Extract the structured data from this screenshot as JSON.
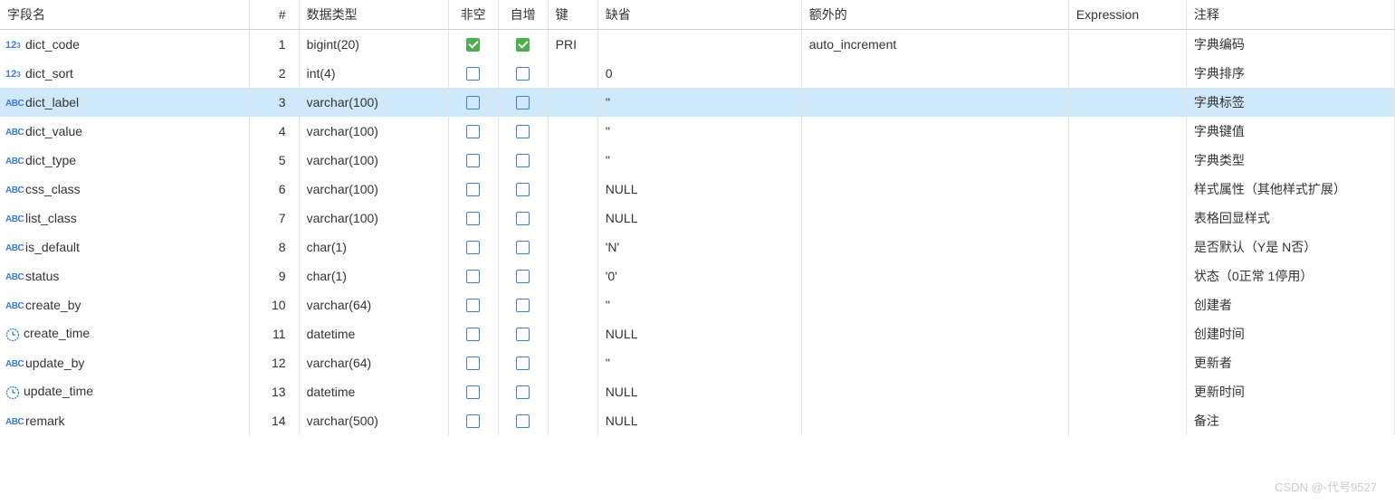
{
  "headers": {
    "name": "字段名",
    "num": "#",
    "type": "数据类型",
    "notnull": "非空",
    "autoinc": "自增",
    "key": "键",
    "default": "缺省",
    "extra": "额外的",
    "expr": "Expression",
    "comment": "注释"
  },
  "rows": [
    {
      "icon": "num",
      "name": "dict_code",
      "num": "1",
      "type": "bigint(20)",
      "notnull": true,
      "autoinc": true,
      "key": "PRI",
      "default": "",
      "extra": "auto_increment",
      "expr": "",
      "comment": "字典编码",
      "selected": false
    },
    {
      "icon": "num",
      "name": "dict_sort",
      "num": "2",
      "type": "int(4)",
      "notnull": false,
      "autoinc": false,
      "key": "",
      "default": "0",
      "extra": "",
      "expr": "",
      "comment": "字典排序",
      "selected": false
    },
    {
      "icon": "abc",
      "name": "dict_label",
      "num": "3",
      "type": "varchar(100)",
      "notnull": false,
      "autoinc": false,
      "key": "",
      "default": "''",
      "extra": "",
      "expr": "",
      "comment": "字典标签",
      "selected": true
    },
    {
      "icon": "abc",
      "name": "dict_value",
      "num": "4",
      "type": "varchar(100)",
      "notnull": false,
      "autoinc": false,
      "key": "",
      "default": "''",
      "extra": "",
      "expr": "",
      "comment": "字典键值",
      "selected": false
    },
    {
      "icon": "abc",
      "name": "dict_type",
      "num": "5",
      "type": "varchar(100)",
      "notnull": false,
      "autoinc": false,
      "key": "",
      "default": "''",
      "extra": "",
      "expr": "",
      "comment": "字典类型",
      "selected": false
    },
    {
      "icon": "abc",
      "name": "css_class",
      "num": "6",
      "type": "varchar(100)",
      "notnull": false,
      "autoinc": false,
      "key": "",
      "default": "NULL",
      "extra": "",
      "expr": "",
      "comment": "样式属性（其他样式扩展）",
      "selected": false
    },
    {
      "icon": "abc",
      "name": "list_class",
      "num": "7",
      "type": "varchar(100)",
      "notnull": false,
      "autoinc": false,
      "key": "",
      "default": "NULL",
      "extra": "",
      "expr": "",
      "comment": "表格回显样式",
      "selected": false
    },
    {
      "icon": "abc",
      "name": "is_default",
      "num": "8",
      "type": "char(1)",
      "notnull": false,
      "autoinc": false,
      "key": "",
      "default": "'N'",
      "extra": "",
      "expr": "",
      "comment": "是否默认（Y是 N否）",
      "selected": false
    },
    {
      "icon": "abc",
      "name": "status",
      "num": "9",
      "type": "char(1)",
      "notnull": false,
      "autoinc": false,
      "key": "",
      "default": "'0'",
      "extra": "",
      "expr": "",
      "comment": "状态（0正常 1停用）",
      "selected": false
    },
    {
      "icon": "abc",
      "name": "create_by",
      "num": "10",
      "type": "varchar(64)",
      "notnull": false,
      "autoinc": false,
      "key": "",
      "default": "''",
      "extra": "",
      "expr": "",
      "comment": "创建者",
      "selected": false
    },
    {
      "icon": "clock",
      "name": "create_time",
      "num": "11",
      "type": "datetime",
      "notnull": false,
      "autoinc": false,
      "key": "",
      "default": "NULL",
      "extra": "",
      "expr": "",
      "comment": "创建时间",
      "selected": false
    },
    {
      "icon": "abc",
      "name": "update_by",
      "num": "12",
      "type": "varchar(64)",
      "notnull": false,
      "autoinc": false,
      "key": "",
      "default": "''",
      "extra": "",
      "expr": "",
      "comment": "更新者",
      "selected": false
    },
    {
      "icon": "clock",
      "name": "update_time",
      "num": "13",
      "type": "datetime",
      "notnull": false,
      "autoinc": false,
      "key": "",
      "default": "NULL",
      "extra": "",
      "expr": "",
      "comment": "更新时间",
      "selected": false
    },
    {
      "icon": "abc",
      "name": "remark",
      "num": "14",
      "type": "varchar(500)",
      "notnull": false,
      "autoinc": false,
      "key": "",
      "default": "NULL",
      "extra": "",
      "expr": "",
      "comment": "备注",
      "selected": false
    }
  ],
  "watermark": "CSDN @-代号9527"
}
